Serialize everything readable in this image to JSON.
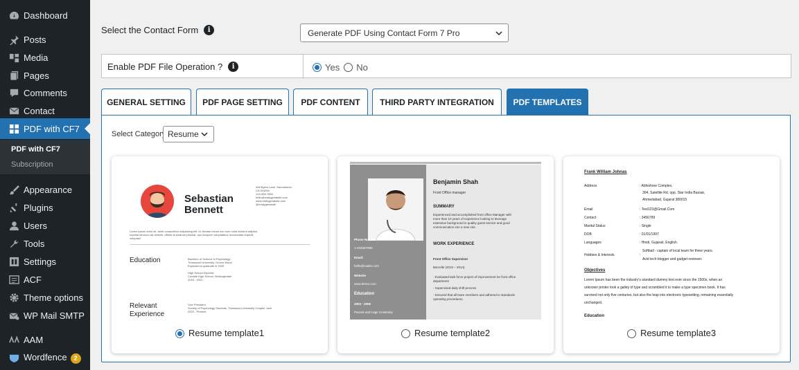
{
  "sidebar": {
    "items": [
      {
        "label": "Dashboard",
        "icon": "dashboard-icon"
      },
      {
        "label": "Posts",
        "icon": "pin-icon"
      },
      {
        "label": "Media",
        "icon": "media-icon"
      },
      {
        "label": "Pages",
        "icon": "pages-icon"
      },
      {
        "label": "Comments",
        "icon": "comment-icon"
      },
      {
        "label": "Contact",
        "icon": "mail-icon"
      },
      {
        "label": "PDF with CF7",
        "icon": "grid-icon"
      },
      {
        "label": "Appearance",
        "icon": "brush-icon"
      },
      {
        "label": "Plugins",
        "icon": "plug-icon"
      },
      {
        "label": "Users",
        "icon": "user-icon"
      },
      {
        "label": "Tools",
        "icon": "wrench-icon"
      },
      {
        "label": "Settings",
        "icon": "settings-icon"
      },
      {
        "label": "ACF",
        "icon": "acf-icon"
      },
      {
        "label": "Theme options",
        "icon": "gear-icon"
      },
      {
        "label": "WP Mail SMTP",
        "icon": "mail-icon"
      },
      {
        "label": "AAM",
        "icon": "aam-icon"
      },
      {
        "label": "Wordfence",
        "icon": "shield-icon",
        "badge": "2"
      }
    ],
    "submenu": [
      {
        "label": "PDF with CF7"
      },
      {
        "label": "Subscription"
      }
    ]
  },
  "form": {
    "label": "Select the Contact Form",
    "selected": "Generate PDF Using Contact Form 7 Pro"
  },
  "pdf_operation": {
    "label": "Enable PDF File Operation ?",
    "yes": "Yes",
    "no": "No",
    "selected": "Yes"
  },
  "tabs": [
    {
      "label": "GENERAL SETTING"
    },
    {
      "label": "PDF PAGE SETTING"
    },
    {
      "label": "PDF CONTENT"
    },
    {
      "label": "THIRD PARTY INTEGRATION"
    },
    {
      "label": "PDF TEMPLATES",
      "active": true
    }
  ],
  "category": {
    "label": "Select Category:",
    "selected": "Resume"
  },
  "templates": [
    {
      "caption": "Resume template1",
      "selected": true
    },
    {
      "caption": "Resume template2",
      "selected": false
    },
    {
      "caption": "Resume template3",
      "selected": false
    }
  ],
  "preview1": {
    "first": "Sebastian",
    "last": "Bennett",
    "address": [
      "408 Byers Lane, Sacramento,",
      "CA 924260",
      "123-456-7890",
      "hello@reallygreatsite.com",
      "www.reallygreatsite.com",
      "@reallygreatsite"
    ],
    "intro": [
      "Lorem ipsum dolor sit, amet consectetur adipisicing elit. Id, beatae minus non cum nulla incidunt adipisci,",
      "repellat laborum ad deleniti, officiis at nostrum placeat, quo tempore voluptatibus recusandae impedit",
      "voluptas!"
    ],
    "education_heading": "Education",
    "education": [
      "Bachelor of Science in Psychology",
      "Tresswood University, Grover Wood",
      "Expected to graduate in 2025",
      "",
      "High School Diploma",
      "Cordale High School, Wolloughdale",
      "2018 - 2021"
    ],
    "relevant_heading": "Relevant",
    "relevant_heading2": "Experience",
    "relevant": [
      "Vice President",
      "Society of Psychology Students, Tresswood University Chapter June",
      "2023 - Present"
    ]
  },
  "preview2": {
    "name": "Benjamin Shah",
    "role": "Front Office manager",
    "summary_heading": "SUMMARY",
    "summary": [
      "Experienced and accomplished front office Manager with",
      "more than 10 years of experience looking to leverage",
      "extensive background in quality guest service and good",
      "communication into a new role."
    ],
    "phone_label": "Phone Number:",
    "phone": "1-234567890",
    "email_label": "Email:",
    "email": "hello@mailto.com",
    "website_label": "Website",
    "website": "www.demo.com",
    "education_label": "Education",
    "edu_years": "2003 - 2006",
    "edu_school": "Pascek and Lage University",
    "work_heading": "WORK EXPERIENCE",
    "job_title": "Front Office Supervisor",
    "job_period": "Barcelle (2010 – 2014)",
    "job_points": [
      "- Evaluated task force project of improvement for front office",
      "department",
      "- Supervised daily shift process",
      "- Ensured that all team members and adhered to standards",
      "operating procedures."
    ]
  },
  "preview3": {
    "name": "Frank William Johnas",
    "rows": [
      {
        "label": "Address",
        "value": ": Abhishree Complex,"
      },
      {
        "label": "",
        "value": "304, Satellite Rd, opp. Star India Bazaar,"
      },
      {
        "label": "",
        "value": "Ahmedabad, Gujarat 380015"
      },
      {
        "label": "Email",
        "value": ": Test123@Gmail.Com"
      },
      {
        "label": "Contact",
        "value": ": 3456789"
      },
      {
        "label": "Marital Status",
        "value": ": Single"
      },
      {
        "label": "DOB",
        "value": ": 01/01/1997"
      },
      {
        "label": "Languages",
        "value": ": Hindi, Gujarati, English."
      },
      {
        "label": "",
        "value": "Softball - captain of local team for three years."
      },
      {
        "label": "Hobbies & Interests",
        "value": ":"
      },
      {
        "label": "",
        "value": "Avid tech blogger and gadget reviewer."
      }
    ],
    "objectives_heading": "Objectives",
    "objectives": [
      "Lorem Ipsum has been the industry's standard dummy text ever since the 1500s, when an",
      "unknown printer took a galley of type and scrambled it to make a type specimen book. It has",
      "survived not only five centuries, but also the leap into electronic typesetting, remaining essentially",
      "unchanged."
    ],
    "education_heading": "Education"
  }
}
